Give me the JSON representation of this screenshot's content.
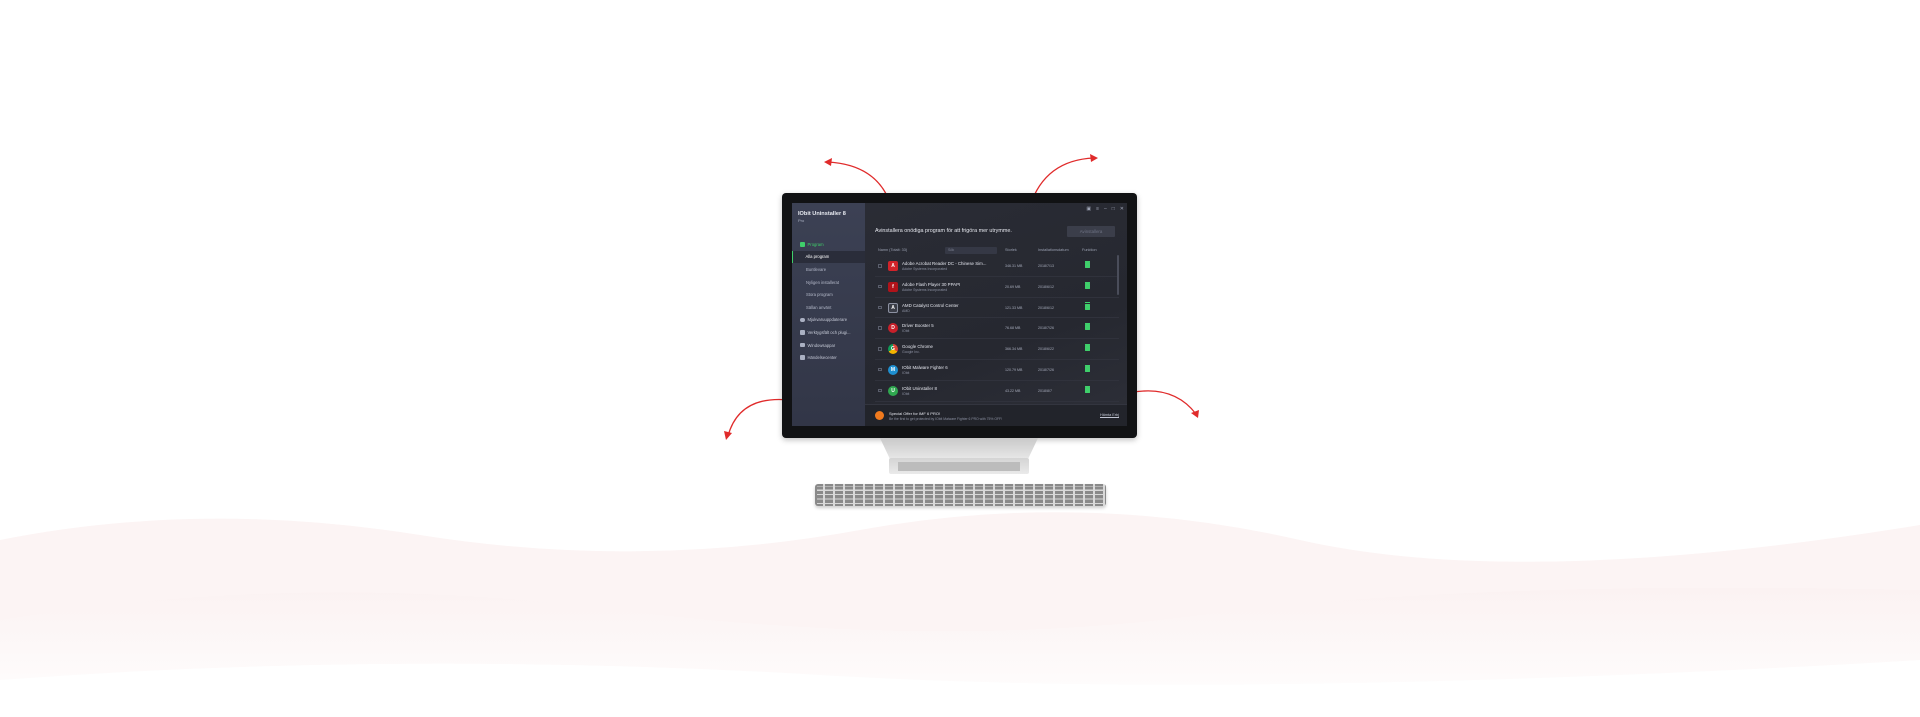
{
  "colors": {
    "accent": "#3fcf6b",
    "arrow": "#e02b2b",
    "sidebar": "#3c4154",
    "main": "#262830"
  },
  "app": {
    "title": "IObit Uninstaller 8",
    "edition": "Pro",
    "headline": "Avinstallera onödiga program för att frigöra mer utrymme.",
    "uninstall_label": "Avinstallera",
    "window_icons": [
      "toolbox-icon",
      "menu-icon",
      "minimize-icon",
      "maximize-icon",
      "close-icon"
    ]
  },
  "sidebar": {
    "items": [
      {
        "label": "Program",
        "icon": "grid-icon",
        "level": "main",
        "state": "active"
      },
      {
        "label": "Alla program",
        "level": "sub",
        "state": "selected"
      },
      {
        "label": "Buntlevare",
        "level": "sub"
      },
      {
        "label": "Nyligen installerat",
        "level": "sub"
      },
      {
        "label": "Stora program",
        "level": "sub"
      },
      {
        "label": "Sällan använt",
        "level": "sub"
      },
      {
        "label": "Mjukvaruuppdaterare",
        "icon": "refresh-icon",
        "level": "main"
      },
      {
        "label": "Verktygsfält och plugi...",
        "icon": "puzzle-icon",
        "level": "main"
      },
      {
        "label": "Windowsappar",
        "icon": "windows-icon",
        "level": "main"
      },
      {
        "label": "Händelsecenter",
        "icon": "flag-icon",
        "level": "main"
      }
    ]
  },
  "table": {
    "headers": {
      "name": "Namn (Totalt: 33)",
      "search_placeholder": "Sök",
      "size": "Storlek",
      "date": "Installationsdatum",
      "action": "Funktion"
    },
    "rows": [
      {
        "name": "Adobe Acrobat Reader DC - Chinese Sim...",
        "publisher": "Adobe Systems Incorporated",
        "size": "346.31 MB",
        "date": "2018/7/13",
        "icon_color": "#d2232a",
        "icon_glyph": "A"
      },
      {
        "name": "Adobe Flash Player 30 PPAPI",
        "publisher": "Adobe Systems Incorporated",
        "size": "20.69 MB",
        "date": "2018/6/12",
        "icon_color": "#b0131a",
        "icon_glyph": "f"
      },
      {
        "name": "AMD Catalyst Control Center",
        "publisher": "AMD",
        "size": "121.33 MB",
        "date": "2018/6/12",
        "icon_color": "#3a3d47",
        "icon_glyph": "A"
      },
      {
        "name": "Driver Booster 5",
        "publisher": "IObit",
        "size": "76.68 MB",
        "date": "2018/7/26",
        "icon_color": "#c8202a",
        "icon_glyph": "D"
      },
      {
        "name": "Google Chrome",
        "publisher": "Google Inc.",
        "size": "366.34 MB",
        "date": "2018/6/22",
        "icon_color": "#e8a21a",
        "icon_glyph": "G"
      },
      {
        "name": "IObit Malware Fighter 6",
        "publisher": "IObit",
        "size": "120.79 MB",
        "date": "2018/7/26",
        "icon_color": "#1e8fd0",
        "icon_glyph": "M"
      },
      {
        "name": "IObit Uninstaller 8",
        "publisher": "IObit",
        "size": "43.22 MB",
        "date": "2018/8/7",
        "icon_color": "#2fa84f",
        "icon_glyph": "U"
      }
    ]
  },
  "footer": {
    "offer_title": "Special Offer for IMF 6 PRO!",
    "offer_desc": "Be the first to get protected by IObit Malware Fighter 6 PRO with 75% OFF!",
    "link": "Hämta Erbj"
  }
}
